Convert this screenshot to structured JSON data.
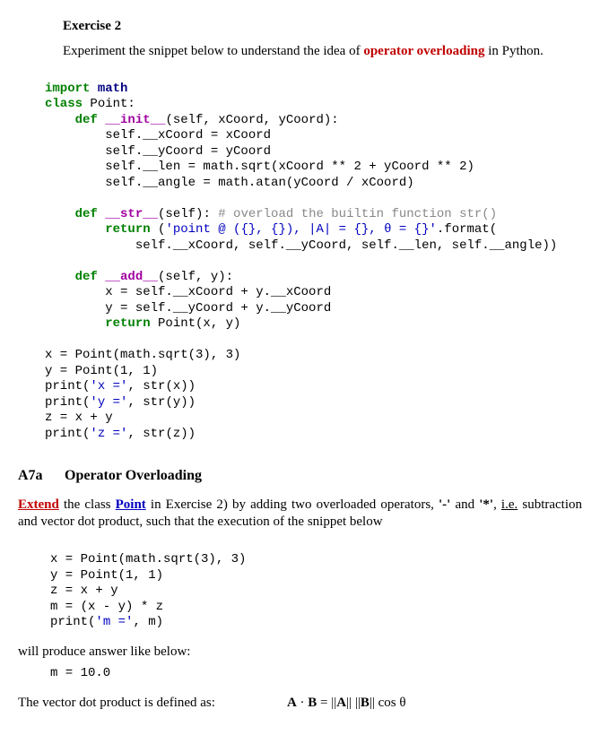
{
  "exercise2": {
    "title": "Exercise 2",
    "intro_pre": "Experiment the snippet below to understand the idea of ",
    "intro_highlight": "operator overloading",
    "intro_post": " in Python."
  },
  "code1": {
    "l01a": "import",
    "l01b": " math",
    "l02a": "class",
    "l02b": " Point:",
    "l03a": "    def",
    "l03b": " __init__",
    "l03c": "(self, xCoord, yCoord):",
    "l04": "        self.__xCoord = xCoord",
    "l05": "        self.__yCoord = yCoord",
    "l06": "        self.__len = math.sqrt(xCoord ** 2 + yCoord ** 2)",
    "l07": "        self.__angle = math.atan(yCoord / xCoord)",
    "l08": "",
    "l09a": "    def",
    "l09b": " __str__",
    "l09c": "(self): ",
    "l09d": "# overload the builtin function str()",
    "l10a": "        return",
    "l10b": " (",
    "l10c": "'point @ ({}, {}), |A| = {}, θ = {}'",
    "l10d": ".format(",
    "l11": "            self.__xCoord, self.__yCoord, self.__len, self.__angle))",
    "l12": "",
    "l13a": "    def",
    "l13b": " __add__",
    "l13c": "(self, y):",
    "l14": "        x = self.__xCoord + y.__xCoord",
    "l15": "        y = self.__yCoord + y.__yCoord",
    "l16a": "        return",
    "l16b": " Point(x, y)",
    "l17": "",
    "l18": "x = Point(math.sqrt(3), 3)",
    "l19": "y = Point(1, 1)",
    "l20a": "print(",
    "l20b": "'x ='",
    "l20c": ", str(x))",
    "l21a": "print(",
    "l21b": "'y ='",
    "l21c": ", str(y))",
    "l22": "z = x + y",
    "l23a": "print(",
    "l23b": "'z ='",
    "l23c": ", str(z))"
  },
  "a7a": {
    "section_label": "A7a",
    "section_title": "Operator Overloading",
    "p1a": "Extend",
    "p1b": " the class ",
    "p1c": "Point",
    "p1d": " in Exercise 2) by adding two overloaded operators, ",
    "p1e": "'-'",
    "p1f": " and ",
    "p1g": "'*'",
    "p1h": ", ",
    "p1i": "i.e.",
    "p2": "subtraction and vector dot product, such that the execution of the snippet below"
  },
  "code2": {
    "l01": "x = Point(math.sqrt(3), 3)",
    "l02": "y = Point(1, 1)",
    "l03": "z = x + y",
    "l04": "m = (x - y) * z",
    "l05a": "print(",
    "l05b": "'m ='",
    "l05c": ", m)"
  },
  "post": {
    "p3": "will produce answer like below:",
    "output": "m = 10.0",
    "p4": "The vector dot product is defined as:",
    "formula": "A · B = ||A|| ||B|| cos θ"
  }
}
